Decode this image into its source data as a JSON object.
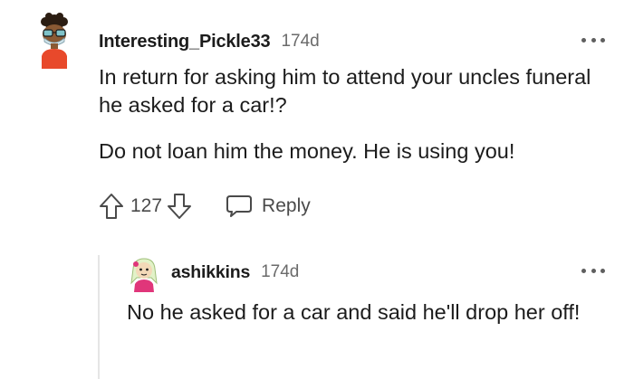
{
  "comment": {
    "username": "Interesting_Pickle33",
    "time": "174d",
    "paragraphs": [
      "In return for asking him to attend your uncles funeral he asked for a car!?",
      "Do not loan him the money. He is using you!"
    ],
    "score": "127",
    "reply_label": "Reply",
    "icons": {
      "upvote": "arrow-up-icon",
      "downvote": "arrow-down-icon",
      "reply": "speech-bubble-icon",
      "more": "more-dots-icon",
      "avatar": "avatar-icon"
    }
  },
  "reply": {
    "username": "ashikkins",
    "time": "174d",
    "text": "No he asked for a car and said he'll drop her off!"
  },
  "colors": {
    "text": "#1c1c1c",
    "meta": "#6b6b6b",
    "icon": "#4a4a4a",
    "thread_line": "#e5e5e5",
    "avatar_shirt": "#e8492b",
    "avatar_reply_accent": "#e0367a"
  }
}
